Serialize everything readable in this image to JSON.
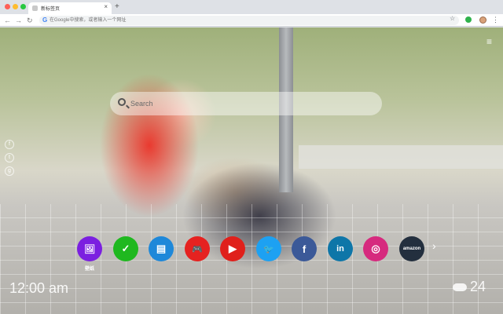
{
  "browser": {
    "tab_title": "新标签页",
    "tab_close": "×",
    "new_tab": "+",
    "back": "←",
    "forward": "→",
    "reload": "↻",
    "omnibox_g": "G",
    "omnibox_placeholder": "在Google中搜索，或者输入一个网址",
    "star": "☆",
    "kebab": "⋮"
  },
  "page": {
    "menu_icon": "≡",
    "search": {
      "placeholder": "Search"
    },
    "social": [
      {
        "glyph": "f",
        "icon": "facebook-icon"
      },
      {
        "glyph": "t",
        "icon": "twitter-icon"
      },
      {
        "glyph": "g",
        "icon": "google-icon"
      }
    ],
    "shortcuts": [
      {
        "glyph": "🖼",
        "label": "壁纸",
        "color": "#7b1fe0",
        "icon": "wallpaper-icon"
      },
      {
        "glyph": "✓",
        "label": "",
        "color": "#1fb81f",
        "icon": "check-icon"
      },
      {
        "glyph": "▤",
        "label": "",
        "color": "#1e88d9",
        "icon": "news-icon"
      },
      {
        "glyph": "🎮",
        "label": "",
        "color": "#e52220",
        "icon": "game-icon"
      },
      {
        "glyph": "▶",
        "label": "",
        "color": "#e0201b",
        "icon": "youtube-icon"
      },
      {
        "glyph": "🐦",
        "label": "",
        "color": "#1da1f2",
        "icon": "twitter-icon"
      },
      {
        "glyph": "f",
        "label": "",
        "color": "#3b5998",
        "icon": "facebook-icon"
      },
      {
        "glyph": "in",
        "label": "",
        "color": "#0e76a8",
        "icon": "linkedin-icon"
      },
      {
        "glyph": "◎",
        "label": "",
        "color": "#d62a7e",
        "icon": "instagram-icon"
      },
      {
        "glyph": "amazon",
        "label": "",
        "color": "#232f3e",
        "icon": "amazon-icon"
      }
    ],
    "next_arrow": "›",
    "clock": "12:00 am",
    "clock_sub": "",
    "temperature": "24"
  }
}
